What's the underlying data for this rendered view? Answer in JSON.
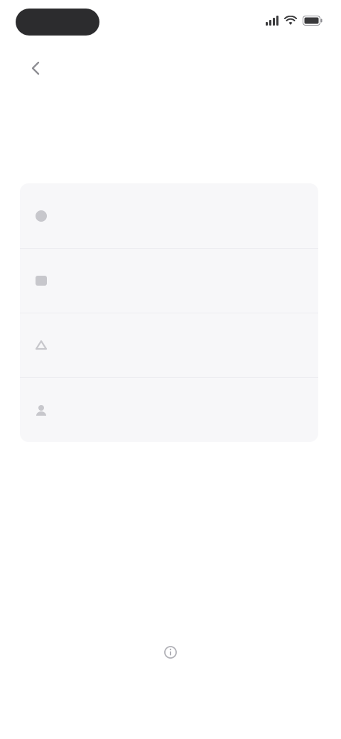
{
  "status_bar": {
    "time": "",
    "signal_icon": "cellular-signal-icon",
    "wifi_icon": "wifi-icon",
    "battery_icon": "battery-icon"
  },
  "nav": {
    "back_icon": "chevron-left-icon",
    "link_label": ""
  },
  "title": "",
  "options": [
    {
      "icon": "option-icon",
      "title": "",
      "subtitle": ""
    },
    {
      "icon": "option-icon",
      "title": "",
      "subtitle": ""
    },
    {
      "icon": "option-icon",
      "title": "",
      "subtitle": ""
    },
    {
      "icon": "option-icon",
      "title": "",
      "subtitle": ""
    }
  ],
  "footer": {
    "icon": "info-icon",
    "title": "",
    "text": ""
  },
  "colors": {
    "accent": "#4a90e2",
    "background": "#ffffff",
    "card": "#f7f7f9",
    "status_pill": "#2c2c2e"
  }
}
